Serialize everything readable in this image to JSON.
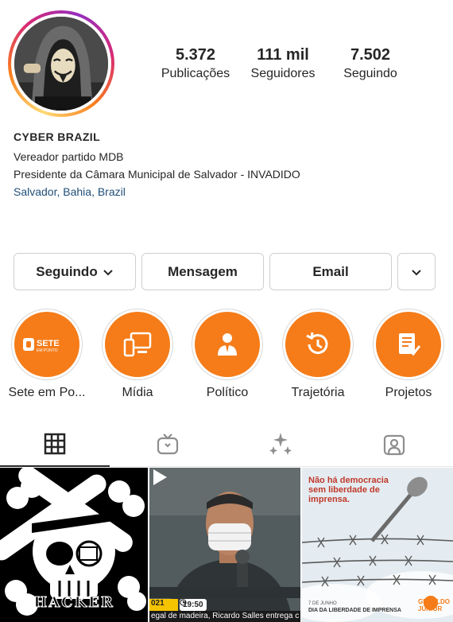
{
  "profile": {
    "avatar_icon": "hooded-anonymous-hacker-photo",
    "stats": [
      {
        "value": "5.372",
        "label": "Publicações"
      },
      {
        "value": "111 mil",
        "label": "Seguidores"
      },
      {
        "value": "7.502",
        "label": "Seguindo"
      }
    ],
    "name": "CYBER BRAZIL",
    "bio_lines": [
      "Vereador partido MDB",
      "Presidente da Câmara Municipal de Salvador - INVADIDO"
    ],
    "location": "Salvador, Bahia, Brazil"
  },
  "actions": {
    "following": "Seguindo",
    "message": "Mensagem",
    "email": "Email",
    "more_icon": "chevron-down-icon"
  },
  "highlights": [
    {
      "label": "Sete em Po...",
      "icon": "sete-em-ponto-logo",
      "logo_text": "SETE",
      "logo_sub": "EM PONTO"
    },
    {
      "label": "Mídia",
      "icon": "devices-icon"
    },
    {
      "label": "Político",
      "icon": "person-suit-icon"
    },
    {
      "label": "Trajetória",
      "icon": "history-icon"
    },
    {
      "label": "Projetos",
      "icon": "clipboard-check-icon"
    }
  ],
  "tabs": [
    {
      "name": "grid",
      "icon": "grid-icon",
      "active": true
    },
    {
      "name": "reels",
      "icon": "reels-tv-icon",
      "active": false
    },
    {
      "name": "guides",
      "icon": "sparkles-icon",
      "active": false
    },
    {
      "name": "tagged",
      "icon": "tagged-person-icon",
      "active": false
    }
  ],
  "posts": {
    "post1": {
      "text": "HACKER"
    },
    "post2": {
      "year": "021",
      "time": "19:50",
      "ticker": "egal de madeira, Ricardo Salles entrega c"
    },
    "post3": {
      "headline": "Não há democracia sem liberdade de imprensa.",
      "date": "7 DE JUNHO",
      "footer": "DIA DA LIBERDADE DE IMPRENSA",
      "brand_1": "GERALDO",
      "brand_2": "JÚNIOR"
    }
  },
  "colors": {
    "accent_orange": "#f57c19",
    "text": "#262626",
    "link_blue": "#1f4e79"
  }
}
